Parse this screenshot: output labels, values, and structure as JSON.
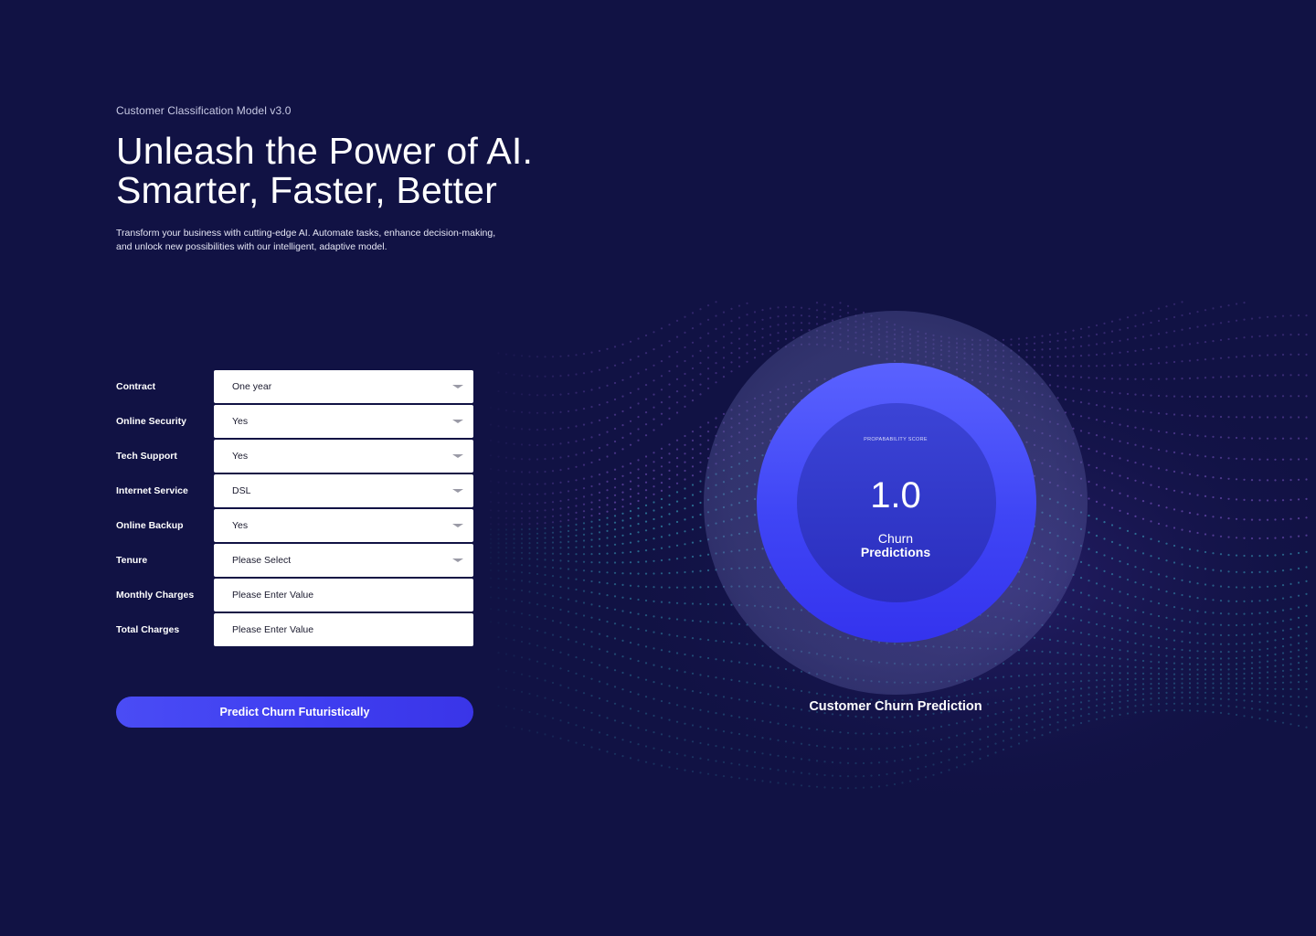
{
  "hero": {
    "eyebrow": "Customer Classification Model v3.0",
    "headline_line1": "Unleash the Power of AI.",
    "headline_line2": "Smarter, Faster, Better",
    "subtext_line1": "Transform your business with cutting-edge AI. Automate tasks, enhance decision-making,",
    "subtext_line2": "and unlock new possibilities with our intelligent, adaptive model."
  },
  "form": {
    "fields": [
      {
        "label": "Contract",
        "value": "One year",
        "kind": "select"
      },
      {
        "label": "Online Security",
        "value": "Yes",
        "kind": "select"
      },
      {
        "label": "Tech Support",
        "value": "Yes",
        "kind": "select"
      },
      {
        "label": "Internet Service",
        "value": "DSL",
        "kind": "select"
      },
      {
        "label": "Online Backup",
        "value": "Yes",
        "kind": "select"
      },
      {
        "label": "Tenure",
        "value": "Please Select",
        "kind": "select"
      },
      {
        "label": "Monthly Charges",
        "value": "Please Enter Value",
        "kind": "input"
      },
      {
        "label": "Total Charges",
        "value": "Please Enter Value",
        "kind": "input"
      }
    ],
    "submit_label": "Predict Churn Futuristically"
  },
  "prediction": {
    "score_caption": "PROPABABILITY SCORE",
    "score_value": "1.0",
    "churn_line1": "Churn",
    "churn_line2": "Predictions",
    "title": "Customer Churn Prediction"
  },
  "colors": {
    "background": "#111244",
    "accent": "#4a4cf5",
    "wave_purple": "#8a5fd6",
    "wave_cyan": "#3fb8d0"
  }
}
